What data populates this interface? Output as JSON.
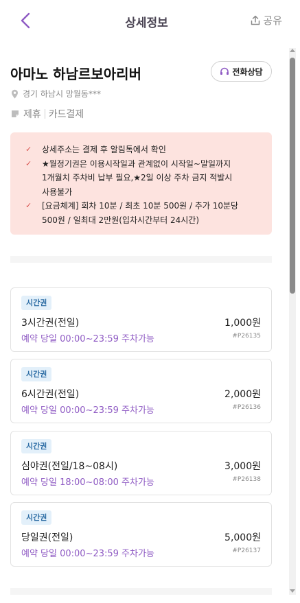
{
  "header": {
    "title": "상세정보",
    "share_label": "공유"
  },
  "lot": {
    "name": "아마노 하남르보아리버",
    "call_button": "전화상담",
    "address": "경기 하남시 망월동***",
    "tags": [
      "제휴",
      "카드결제"
    ]
  },
  "notice": {
    "items": [
      [
        "상세주소는 결제 후 알림톡에서 확인"
      ],
      [
        "★월정기권은 이용시작일과 관계없이 시작일~말일까지",
        "1개월치 주차비 납부 필요,★2일 이상 주차 금지 적발시",
        "사용불가"
      ],
      [
        "[요금체계] 회차 10분 / 최초 10분 500원 / 추가 10분당",
        "500원 / 일최대 2만원(입차시간부터 24시간)"
      ]
    ]
  },
  "tickets": [
    {
      "badge": "시간권",
      "name": "3시간권(전일)",
      "price": "1,000원",
      "time": "예약 당일 00:00~23:59 주차가능",
      "code": "#P26135"
    },
    {
      "badge": "시간권",
      "name": "6시간권(전일)",
      "price": "2,000원",
      "time": "예약 당일 00:00~23:59 주차가능",
      "code": "#P26136"
    },
    {
      "badge": "시간권",
      "name": "심야권(전일/18~08시)",
      "price": "3,000원",
      "time": "예약 당일 18:00~08:00 주차가능",
      "code": "#P26138"
    },
    {
      "badge": "시간권",
      "name": "당일권(전일)",
      "price": "5,000원",
      "time": "예약 당일 00:00~23:59 주차가능",
      "code": "#P26137"
    }
  ],
  "colors": {
    "accent_purple": "#8f5bc4",
    "notice_bg": "#fde3df",
    "badge_bg": "#e3f0fa",
    "badge_text": "#2f6ea5"
  }
}
